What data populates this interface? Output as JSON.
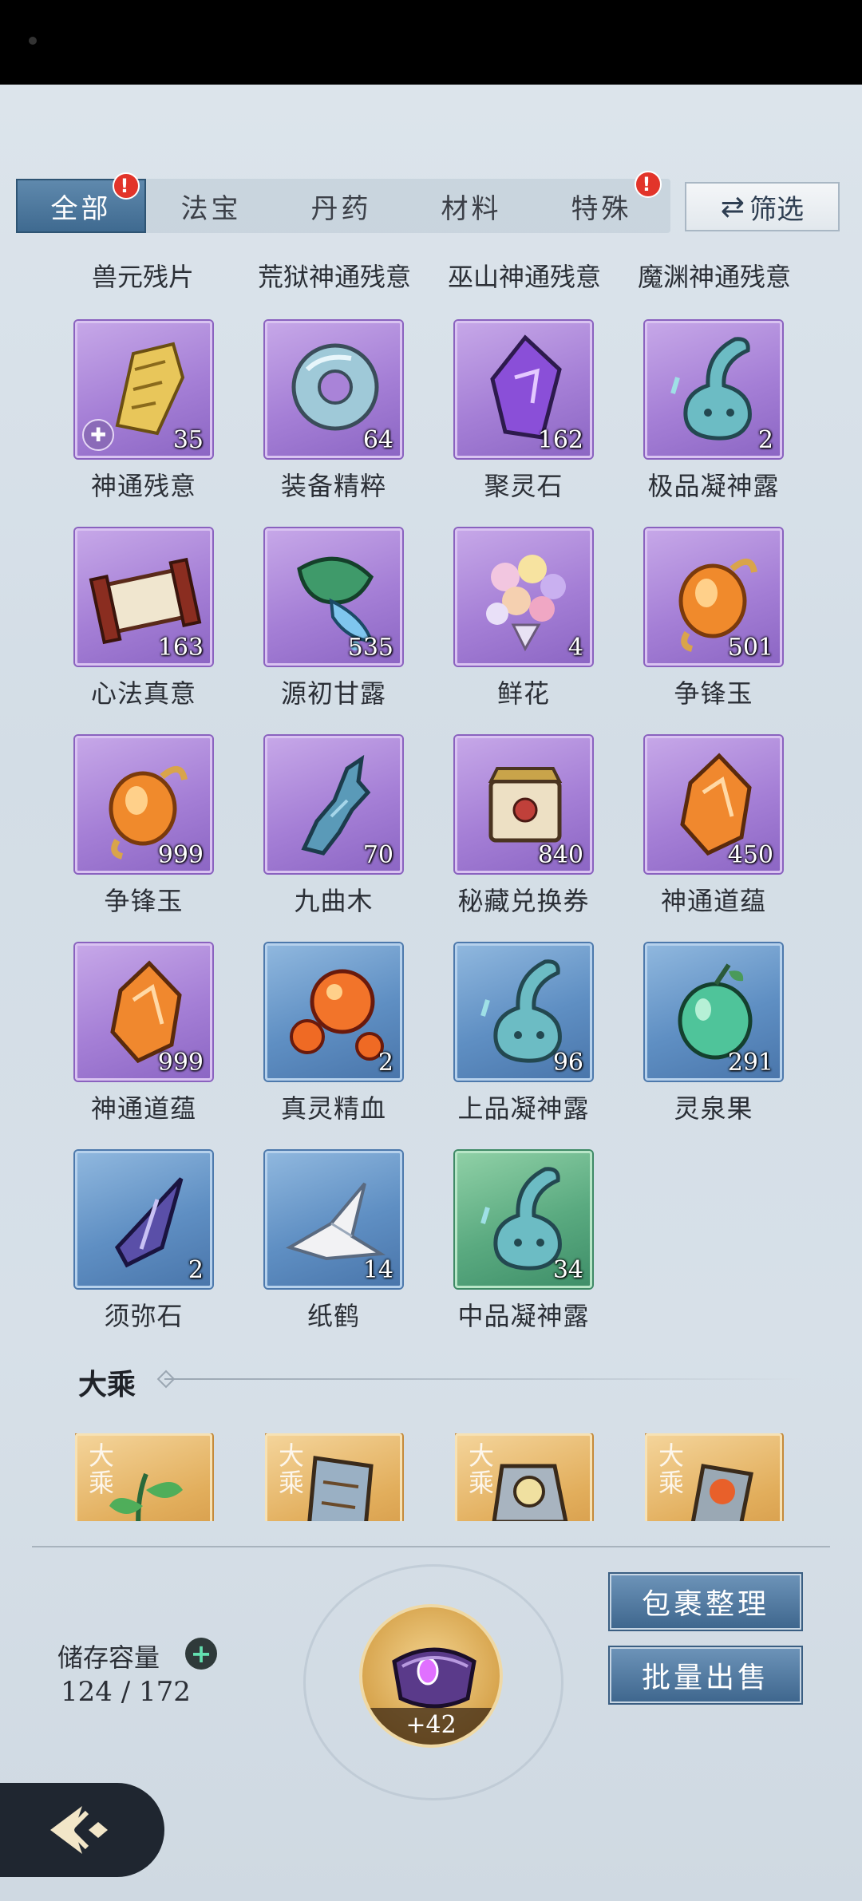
{
  "tabs": [
    {
      "label": "全部",
      "active": true,
      "badge": "!"
    },
    {
      "label": "法宝",
      "active": false,
      "badge": ""
    },
    {
      "label": "丹药",
      "active": false,
      "badge": ""
    },
    {
      "label": "材料",
      "active": false,
      "badge": ""
    },
    {
      "label": "特殊",
      "active": false,
      "badge": "!"
    }
  ],
  "filter": {
    "icon": "⇄",
    "label": "筛选"
  },
  "top_labels": [
    "兽元残片",
    "荒狱神通残意",
    "巫山神通残意",
    "魔渊神通残意"
  ],
  "items": [
    {
      "name": "神通残意",
      "count": "35",
      "rarity": "purple",
      "icon": "golden-fragment-icon"
    },
    {
      "name": "装备精粹",
      "count": "64",
      "rarity": "purple",
      "icon": "jade-ring-icon"
    },
    {
      "name": "聚灵石",
      "count": "162",
      "rarity": "purple",
      "icon": "purple-crystal-icon"
    },
    {
      "name": "极品凝神露",
      "count": "2",
      "rarity": "purple",
      "icon": "dew-gourd-icon"
    },
    {
      "name": "心法真意",
      "count": "163",
      "rarity": "purple",
      "icon": "scroll-icon"
    },
    {
      "name": "源初甘露",
      "count": "535",
      "rarity": "purple",
      "icon": "leaf-dew-icon"
    },
    {
      "name": "鲜花",
      "count": "4",
      "rarity": "purple",
      "icon": "flower-bouquet-icon"
    },
    {
      "name": "争锋玉",
      "count": "501",
      "rarity": "purple",
      "icon": "amber-jade-icon"
    },
    {
      "name": "争锋玉",
      "count": "999",
      "rarity": "purple",
      "icon": "amber-jade-icon"
    },
    {
      "name": "九曲木",
      "count": "70",
      "rarity": "purple",
      "icon": "wood-branch-icon"
    },
    {
      "name": "秘藏兑换券",
      "count": "840",
      "rarity": "purple",
      "icon": "voucher-icon"
    },
    {
      "name": "神通道蕴",
      "count": "450",
      "rarity": "purple",
      "icon": "orange-crystal-icon"
    },
    {
      "name": "神通道蕴",
      "count": "999",
      "rarity": "purple",
      "icon": "orange-crystal-icon"
    },
    {
      "name": "真灵精血",
      "count": "2",
      "rarity": "blue",
      "icon": "blood-orbs-icon"
    },
    {
      "name": "上品凝神露",
      "count": "96",
      "rarity": "blue",
      "icon": "dew-gourd-icon"
    },
    {
      "name": "灵泉果",
      "count": "291",
      "rarity": "blue",
      "icon": "spirit-fruit-icon"
    },
    {
      "name": "须弥石",
      "count": "2",
      "rarity": "blue",
      "icon": "dark-crystal-icon"
    },
    {
      "name": "纸鹤",
      "count": "14",
      "rarity": "blue",
      "icon": "paper-crane-icon"
    },
    {
      "name": "中品凝神露",
      "count": "34",
      "rarity": "green",
      "icon": "dew-gourd-icon"
    }
  ],
  "section": {
    "title": "大乘"
  },
  "dacheng_items": [
    {
      "tag": "大乘",
      "icon": "herb-plant-icon"
    },
    {
      "tag": "大乘",
      "icon": "talisman-icon"
    },
    {
      "tag": "大乘",
      "icon": "mirror-icon"
    },
    {
      "tag": "大乘",
      "icon": "flame-fan-icon"
    }
  ],
  "capacity": {
    "label": "储存容量",
    "plus": "+",
    "value": "124 / 172"
  },
  "ring": {
    "plus": "+42",
    "icon": "storage-ring-icon"
  },
  "buttons": {
    "sort": "包裹整理",
    "sell": "批量出售"
  },
  "colors": {
    "accent": "#3f6a90",
    "badge": "#e2342a",
    "purple": "#a57fd6",
    "blue": "#5f8fc3",
    "green": "#5aaa80",
    "gold": "#e2ae5c"
  }
}
